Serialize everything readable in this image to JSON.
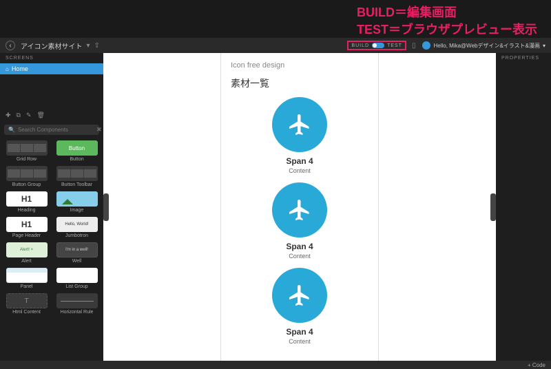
{
  "annotation": {
    "line1": "BUILD＝編集画面",
    "line2": "TEST＝ブラウザプレビュー表示"
  },
  "topbar": {
    "project_title": "アイコン素材サイト",
    "mode_build": "BUILD",
    "mode_test": "TEST",
    "greeting": "Hello, Mika@Webデザイン&イラスト&漫画"
  },
  "left": {
    "screens_label": "SCREENS",
    "home_label": "Home",
    "search_placeholder": "Search Components"
  },
  "components": [
    {
      "preview_text": "",
      "label": "Grid Row",
      "type": "grid"
    },
    {
      "preview_text": "Button",
      "label": "Button",
      "type": "button"
    },
    {
      "preview_text": "",
      "label": "Button Group",
      "type": "grid"
    },
    {
      "preview_text": "",
      "label": "Button Toolbar",
      "type": "grid"
    },
    {
      "preview_text": "H1",
      "label": "Heading",
      "type": "h1"
    },
    {
      "preview_text": "",
      "label": "Image",
      "type": "image"
    },
    {
      "preview_text": "H1",
      "label": "Page Header",
      "type": "h1"
    },
    {
      "preview_text": "Hello, World!",
      "label": "Jumbotron",
      "type": "jumbo"
    },
    {
      "preview_text": "Alert!  ×",
      "label": "Alert",
      "type": "alert"
    },
    {
      "preview_text": "I'm in a well!",
      "label": "Well",
      "type": "well"
    },
    {
      "preview_text": "",
      "label": "Panel",
      "type": "panel"
    },
    {
      "preview_text": "",
      "label": "List Group",
      "type": "list"
    },
    {
      "preview_text": "T",
      "label": "Html Content",
      "type": "html"
    },
    {
      "preview_text": "",
      "label": "Horizontal Rule",
      "type": "hr"
    }
  ],
  "canvas": {
    "header": "Icon free design",
    "title": "素材一覧",
    "cards": [
      {
        "title": "Span 4",
        "content": "Content"
      },
      {
        "title": "Span 4",
        "content": "Content"
      },
      {
        "title": "Span 4",
        "content": "Content"
      }
    ]
  },
  "right": {
    "properties_label": "PROPERTIES"
  },
  "bottom": {
    "code_label": "+ Code"
  }
}
